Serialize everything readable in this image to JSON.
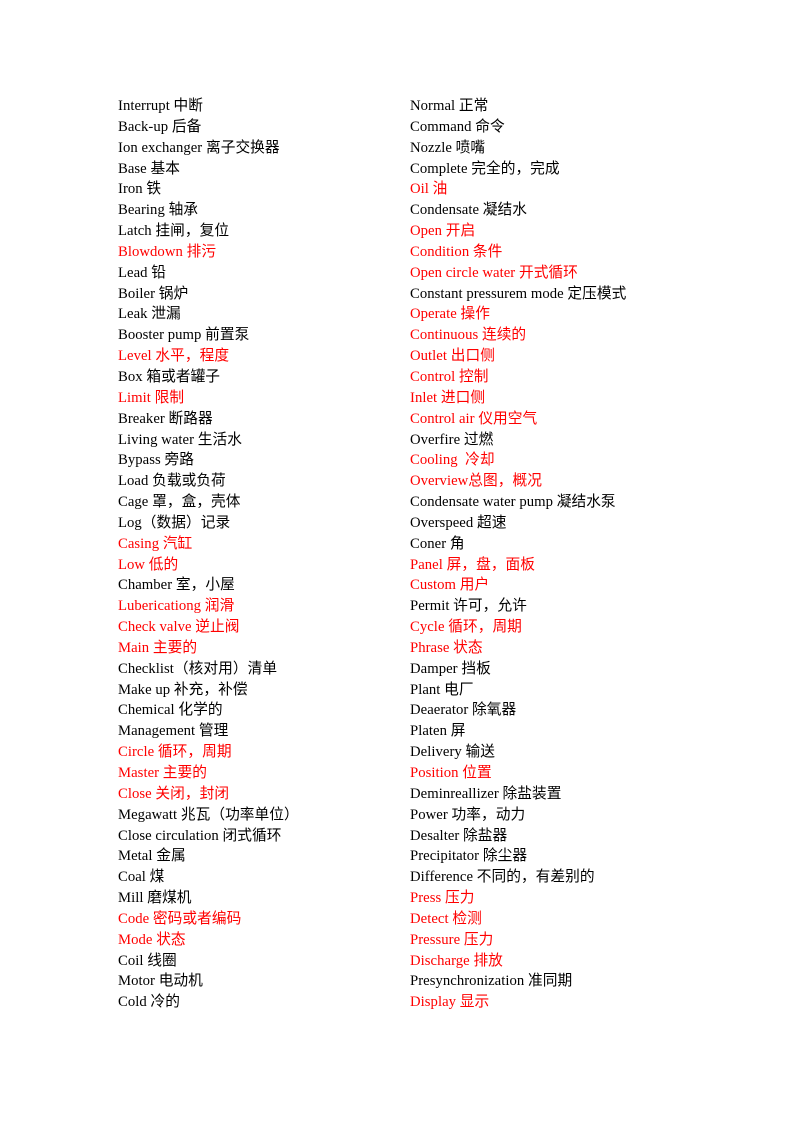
{
  "document": {
    "type": "bilingual-glossary",
    "page_background": "#ffffff",
    "default_text_color": "#000000",
    "highlight_text_color": "#ff0000",
    "columns": [
      {
        "name": "left-column",
        "entries": [
          {
            "text": "Interrupt 中断",
            "color": "black"
          },
          {
            "text": "Back-up 后备",
            "color": "black"
          },
          {
            "text": "Ion exchanger 离子交换器",
            "color": "black"
          },
          {
            "text": "Base 基本",
            "color": "black"
          },
          {
            "text": "Iron 铁",
            "color": "black"
          },
          {
            "text": "Bearing 轴承",
            "color": "black"
          },
          {
            "text": "Latch 挂闸，复位",
            "color": "black"
          },
          {
            "text": "Blowdown 排污",
            "color": "red"
          },
          {
            "text": "Lead 铅",
            "color": "black"
          },
          {
            "text": "Boiler 锅炉",
            "color": "black"
          },
          {
            "text": "Leak 泄漏",
            "color": "black"
          },
          {
            "text": "Booster pump 前置泵",
            "color": "black"
          },
          {
            "text": "Level 水平，程度",
            "color": "red"
          },
          {
            "text": "Box 箱或者罐子",
            "color": "black"
          },
          {
            "text": "Limit 限制",
            "color": "red"
          },
          {
            "text": "Breaker 断路器",
            "color": "black"
          },
          {
            "text": "Living water 生活水",
            "color": "black"
          },
          {
            "text": "Bypass 旁路",
            "color": "black"
          },
          {
            "text": "Load 负载或负荷",
            "color": "black"
          },
          {
            "text": "Cage 罩，盒，壳体",
            "color": "black"
          },
          {
            "text": "Log（数据）记录",
            "color": "black"
          },
          {
            "text": "Casing 汽缸",
            "color": "red"
          },
          {
            "text": "Low 低的",
            "color": "red"
          },
          {
            "text": "Chamber 室，小屋",
            "color": "black"
          },
          {
            "text": "Lubericationg 润滑",
            "color": "red"
          },
          {
            "text": "Check valve 逆止阀",
            "color": "red"
          },
          {
            "text": "Main 主要的",
            "color": "red"
          },
          {
            "text": "Checklist（核对用）清单",
            "color": "black"
          },
          {
            "text": "Make up 补充，补偿",
            "color": "black"
          },
          {
            "text": "Chemical 化学的",
            "color": "black"
          },
          {
            "text": "Management 管理",
            "color": "black"
          },
          {
            "text": "Circle 循环，周期",
            "color": "red"
          },
          {
            "text": "Master 主要的",
            "color": "red"
          },
          {
            "text": "Close 关闭，封闭",
            "color": "red"
          },
          {
            "text": "Megawatt 兆瓦（功率单位）",
            "color": "black"
          },
          {
            "text": "Close circulation 闭式循环",
            "color": "black"
          },
          {
            "text": "Metal 金属",
            "color": "black"
          },
          {
            "text": "Coal 煤",
            "color": "black"
          },
          {
            "text": "Mill 磨煤机",
            "color": "black"
          },
          {
            "text": "Code 密码或者编码",
            "color": "red"
          },
          {
            "text": "Mode 状态",
            "color": "red"
          },
          {
            "text": "Coil 线圈",
            "color": "black"
          },
          {
            "text": "Motor 电动机",
            "color": "black"
          },
          {
            "text": "Cold 冷的",
            "color": "black"
          }
        ]
      },
      {
        "name": "right-column",
        "entries": [
          {
            "text": "Normal 正常",
            "color": "black"
          },
          {
            "text": "Command 命令",
            "color": "black"
          },
          {
            "text": "Nozzle 喷嘴",
            "color": "black"
          },
          {
            "text": "Complete 完全的，完成",
            "color": "black"
          },
          {
            "text": "Oil 油",
            "color": "red"
          },
          {
            "text": "Condensate 凝结水",
            "color": "black"
          },
          {
            "text": "Open 开启",
            "color": "red"
          },
          {
            "text": "Condition 条件",
            "color": "red"
          },
          {
            "text": "Open circle water 开式循环",
            "color": "red"
          },
          {
            "text": "Constant pressurem mode 定压模式",
            "color": "black"
          },
          {
            "text": "Operate 操作",
            "color": "red"
          },
          {
            "text": "Continuous 连续的",
            "color": "red"
          },
          {
            "text": "Outlet 出口侧",
            "color": "red"
          },
          {
            "text": "Control 控制",
            "color": "red"
          },
          {
            "text": "Inlet 进口侧",
            "color": "red"
          },
          {
            "text": "Control air 仪用空气",
            "color": "red"
          },
          {
            "text": "Overfire 过燃",
            "color": "black"
          },
          {
            "text": "Cooling  冷却",
            "color": "red"
          },
          {
            "text": "Overview总图，概况",
            "color": "red"
          },
          {
            "text": "Condensate water pump 凝结水泵",
            "color": "black"
          },
          {
            "text": "Overspeed 超速",
            "color": "black"
          },
          {
            "text": "Coner 角",
            "color": "black"
          },
          {
            "text": "Panel 屏，盘，面板",
            "color": "red"
          },
          {
            "text": "Custom 用户",
            "color": "red"
          },
          {
            "text": "Permit 许可，允许",
            "color": "black"
          },
          {
            "text": "Cycle 循环，周期",
            "color": "red"
          },
          {
            "text": "Phrase 状态",
            "color": "red"
          },
          {
            "text": "Damper 挡板",
            "color": "black"
          },
          {
            "text": "Plant 电厂",
            "color": "black"
          },
          {
            "text": "Deaerator 除氧器",
            "color": "black"
          },
          {
            "text": "Platen 屏",
            "color": "black"
          },
          {
            "text": "Delivery 输送",
            "color": "black"
          },
          {
            "text": "Position 位置",
            "color": "red"
          },
          {
            "text": "Deminreallizer 除盐装置",
            "color": "black"
          },
          {
            "text": "Power 功率，动力",
            "color": "black"
          },
          {
            "text": "Desalter 除盐器",
            "color": "black"
          },
          {
            "text": "Precipitator 除尘器",
            "color": "black"
          },
          {
            "text": "Difference 不同的，有差别的",
            "color": "black"
          },
          {
            "text": "Press 压力",
            "color": "red"
          },
          {
            "text": "Detect 检测",
            "color": "red"
          },
          {
            "text": "Pressure 压力",
            "color": "red"
          },
          {
            "text": "Discharge 排放",
            "color": "red"
          },
          {
            "text": "Presynchronization 准同期",
            "color": "black"
          },
          {
            "text": "Display 显示",
            "color": "red"
          }
        ]
      }
    ]
  }
}
